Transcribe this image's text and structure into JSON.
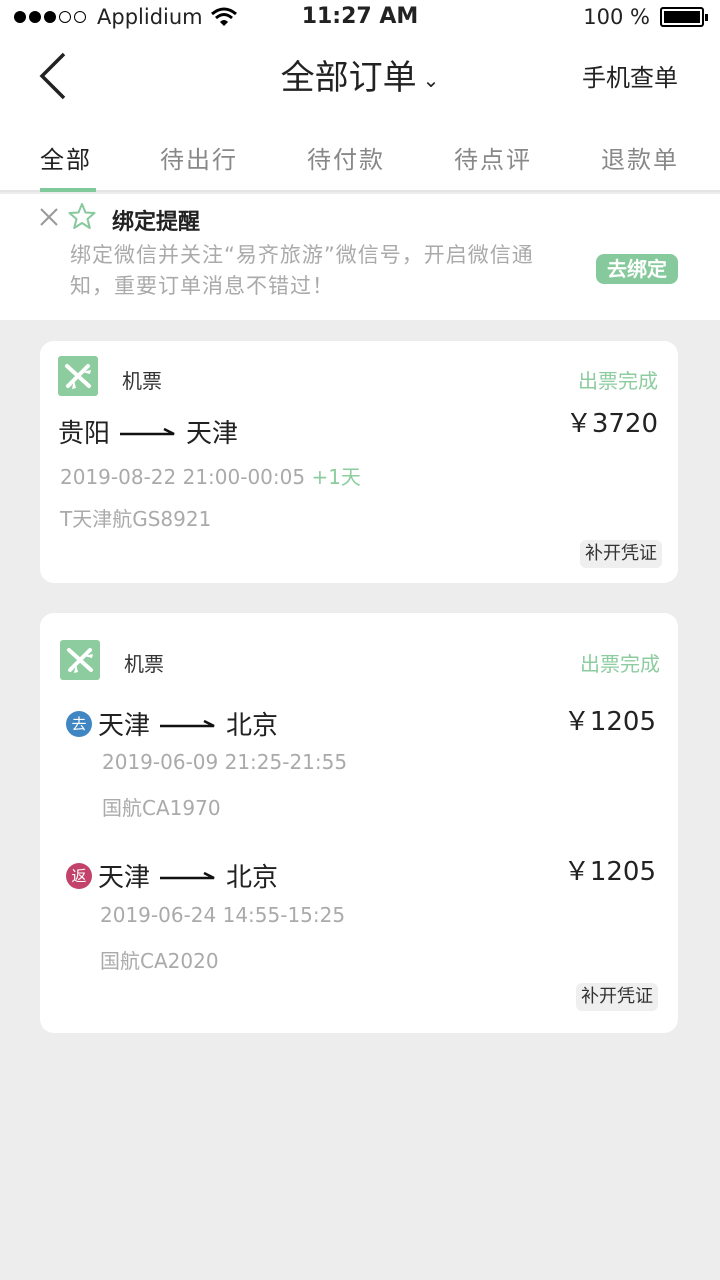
{
  "status_bar": {
    "carrier": "Applidium",
    "time": "11:27 AM",
    "battery": "100 %"
  },
  "nav": {
    "title": "全部订单",
    "right_action": "手机查单"
  },
  "tabs": [
    {
      "label": "全部",
      "active": true
    },
    {
      "label": "待出行",
      "active": false
    },
    {
      "label": "待付款",
      "active": false
    },
    {
      "label": "待点评",
      "active": false
    },
    {
      "label": "退款单",
      "active": false
    }
  ],
  "reminder": {
    "title": "绑定提醒",
    "text": "绑定微信并关注“易齐旅游”微信号，开启微信通知，重要订单消息不错过！",
    "button": "去绑定"
  },
  "orders": [
    {
      "type": "机票",
      "status": "出票完成",
      "from": "贵阳",
      "to": "天津",
      "price": "￥3720",
      "date_time": "2019-08-22  21:00-00:05",
      "next_day": "+1天",
      "flight": "T天津航GS8921",
      "voucher": "补开凭证"
    },
    {
      "type": "机票",
      "status": "出票完成",
      "legs": [
        {
          "badge": "去",
          "from": "天津",
          "to": "北京",
          "price": "￥1205",
          "date_time": "2019-06-09  21:25-21:55",
          "flight": "国航CA1970"
        },
        {
          "badge": "返",
          "from": "天津",
          "to": "北京",
          "price": "￥1205",
          "date_time": "2019-06-24 14:55-15:25",
          "flight": "国航CA2020"
        }
      ],
      "voucher": "补开凭证"
    }
  ],
  "colors": {
    "accent_green": "#8dcc9f",
    "outbound_badge": "#3f86c3",
    "return_badge": "#c2426b"
  }
}
